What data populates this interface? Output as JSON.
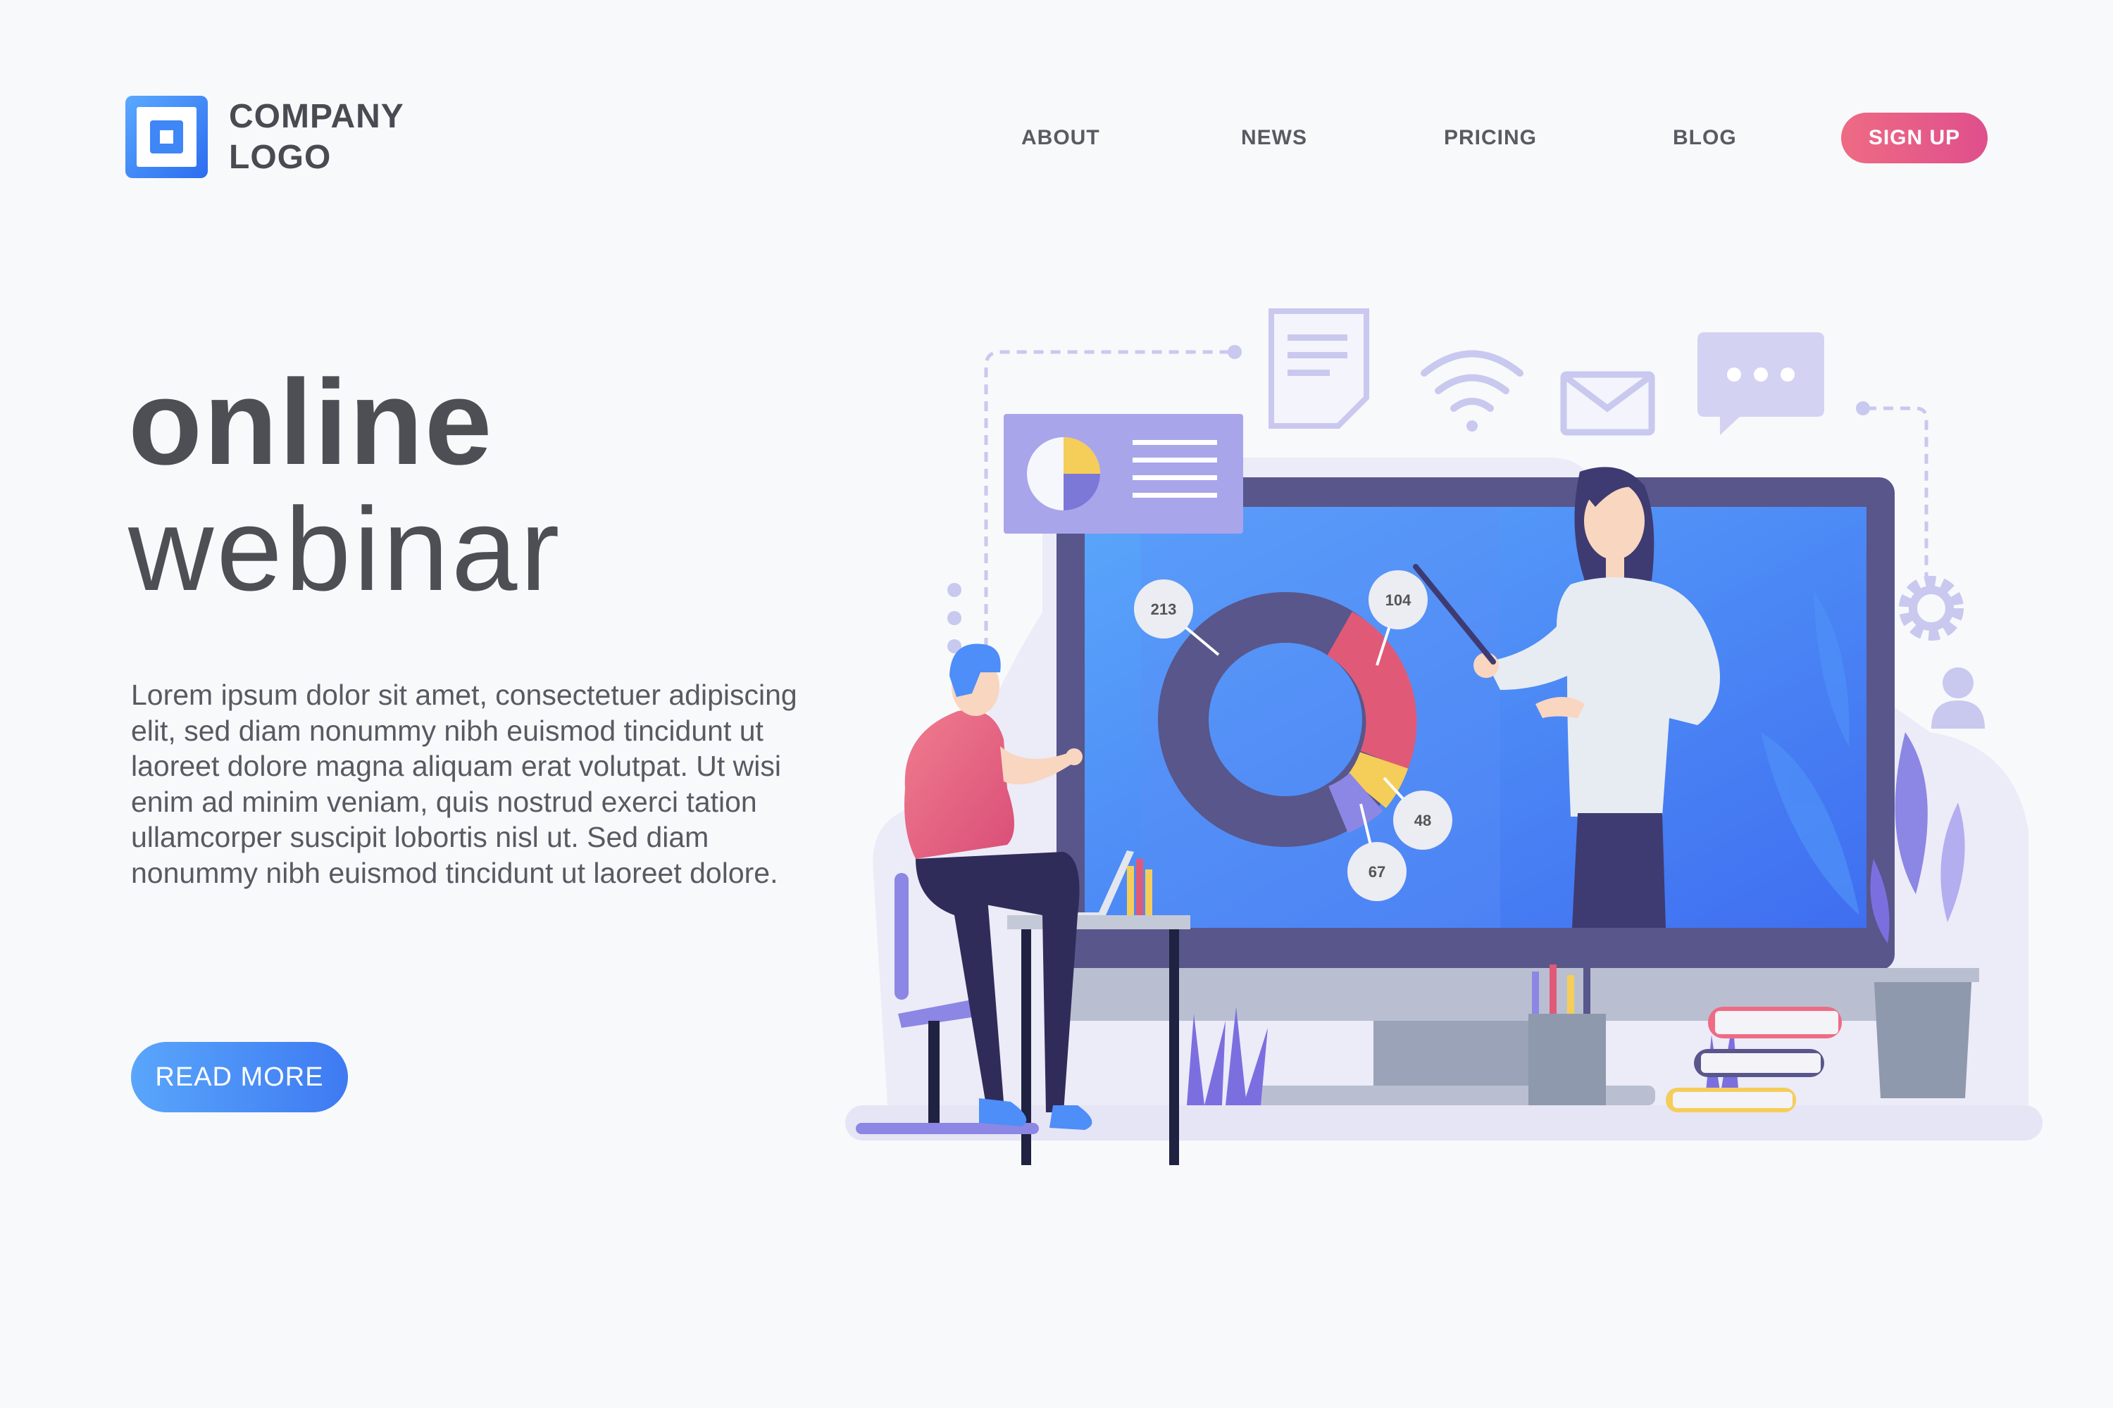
{
  "header": {
    "logo_line1": "COMPANY",
    "logo_line2": "LOGO",
    "nav": [
      {
        "label": "ABOUT"
      },
      {
        "label": "NEWS"
      },
      {
        "label": "PRICING"
      },
      {
        "label": "BLOG"
      }
    ],
    "signup_label": "SIGN UP"
  },
  "hero": {
    "title_line1": "online",
    "title_line2": "webinar",
    "body": "Lorem ipsum dolor sit amet, consectetuer adipiscing elit, sed diam nonummy nibh euismod tincidunt ut laoreet dolore magna aliquam erat volutpat. Ut wisi enim ad minim veniam, quis nostrud exerci tation ullamcorper suscipit lobortis nisl ut. Sed diam nonummy nibh euismod tincidunt ut laoreet dolore.",
    "read_more_label": "READ MORE"
  },
  "illustration": {
    "chart_labels": [
      "213",
      "104",
      "48",
      "67"
    ],
    "colors": {
      "primary_blue": "#3e7af2",
      "accent_pink": "#ee6b83",
      "monitor_frame": "#58568a",
      "lavender": "#c9c8ef"
    },
    "icons": [
      "document-icon",
      "wifi-icon",
      "mail-icon",
      "chat-icon",
      "gear-icon",
      "user-icon",
      "pie-chart-icon"
    ]
  },
  "colors": {
    "background": "#f8f9fb",
    "text": "#4e4e55"
  }
}
